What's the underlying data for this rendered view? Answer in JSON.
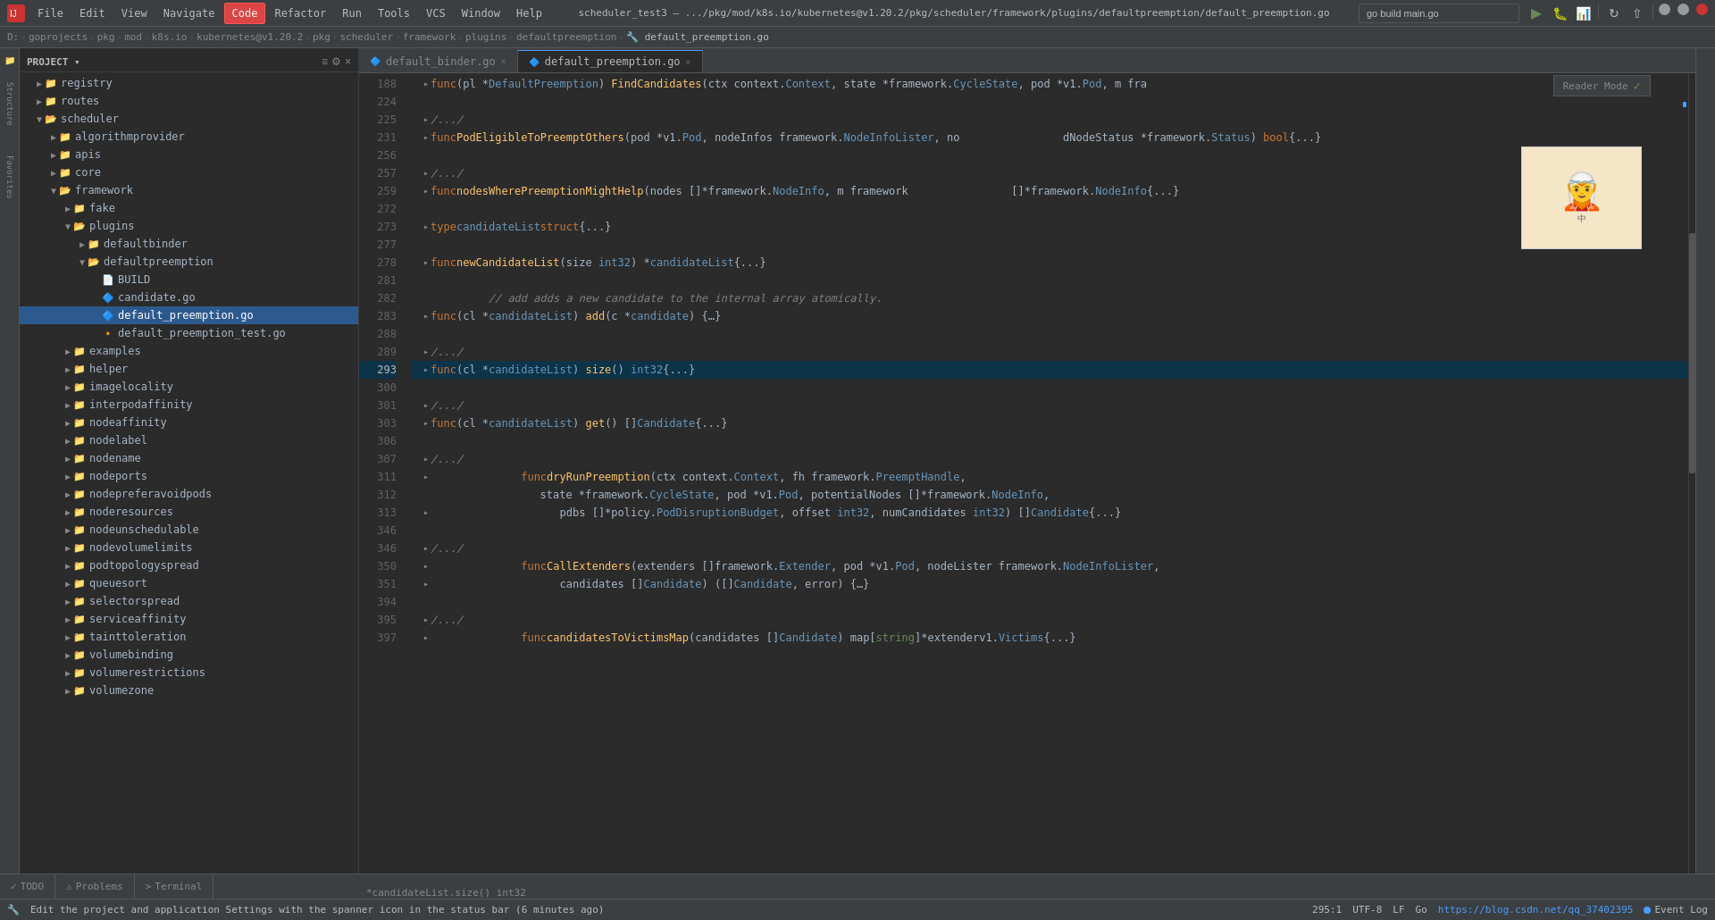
{
  "titlebar": {
    "title": "scheduler_test3 – .../pkg/mod/k8s.io/kubernetes@v1.20.2/pkg/scheduler/framework/plugins/defaultpreemption/default_preemption.go",
    "menus": [
      "File",
      "Edit",
      "View",
      "Navigate",
      "Code",
      "Refactor",
      "Run",
      "Tools",
      "VCS",
      "Window",
      "Help"
    ],
    "active_menu": "Code",
    "run_config": "go build main.go"
  },
  "breadcrumb": {
    "parts": [
      "D:",
      "goprojects",
      "pkg",
      "mod",
      "k8s.io",
      "kubernetes@v1.20.2",
      "pkg",
      "scheduler",
      "framework",
      "plugins",
      "defaultpreemption",
      "default_preemption.go"
    ]
  },
  "tabs": [
    {
      "id": "default_binder",
      "label": "default_binder.go",
      "active": false
    },
    {
      "id": "default_preemption",
      "label": "default_preemption.go",
      "active": true
    }
  ],
  "filetree": {
    "header": "Project",
    "items": [
      {
        "id": "registry",
        "label": "registry",
        "type": "folder",
        "indent": 1,
        "expanded": false
      },
      {
        "id": "routes",
        "label": "routes",
        "type": "folder",
        "indent": 1,
        "expanded": false
      },
      {
        "id": "scheduler",
        "label": "scheduler",
        "type": "folder",
        "indent": 1,
        "expanded": true
      },
      {
        "id": "algorithmprovider",
        "label": "algorithmprovider",
        "type": "folder",
        "indent": 2,
        "expanded": false
      },
      {
        "id": "apis",
        "label": "apis",
        "type": "folder",
        "indent": 2,
        "expanded": false
      },
      {
        "id": "core",
        "label": "core",
        "type": "folder",
        "indent": 2,
        "expanded": false
      },
      {
        "id": "framework",
        "label": "framework",
        "type": "folder",
        "indent": 2,
        "expanded": true
      },
      {
        "id": "fake",
        "label": "fake",
        "type": "folder",
        "indent": 3,
        "expanded": false
      },
      {
        "id": "plugins",
        "label": "plugins",
        "type": "folder",
        "indent": 3,
        "expanded": true
      },
      {
        "id": "defaultbinder",
        "label": "defaultbinder",
        "type": "folder",
        "indent": 4,
        "expanded": false
      },
      {
        "id": "defaultpreemption",
        "label": "defaultpreemption",
        "type": "folder",
        "indent": 4,
        "expanded": true
      },
      {
        "id": "BUILD",
        "label": "BUILD",
        "type": "build",
        "indent": 5
      },
      {
        "id": "candidate.go",
        "label": "candidate.go",
        "type": "go",
        "indent": 5
      },
      {
        "id": "default_preemption.go",
        "label": "default_preemption.go",
        "type": "go",
        "indent": 5,
        "selected": true
      },
      {
        "id": "default_preemption_test.go",
        "label": "default_preemption_test.go",
        "type": "gotest",
        "indent": 5
      },
      {
        "id": "examples",
        "label": "examples",
        "type": "folder",
        "indent": 3,
        "expanded": false
      },
      {
        "id": "helper",
        "label": "helper",
        "type": "folder",
        "indent": 3,
        "expanded": false
      },
      {
        "id": "imagelocality",
        "label": "imagelocality",
        "type": "folder",
        "indent": 3,
        "expanded": false
      },
      {
        "id": "interpodaffinity",
        "label": "interpodaffinity",
        "type": "folder",
        "indent": 3,
        "expanded": false
      },
      {
        "id": "nodeaffinity",
        "label": "nodeaffinity",
        "type": "folder",
        "indent": 3,
        "expanded": false
      },
      {
        "id": "nodelabel",
        "label": "nodelabel",
        "type": "folder",
        "indent": 3,
        "expanded": false
      },
      {
        "id": "nodename",
        "label": "nodename",
        "type": "folder",
        "indent": 3,
        "expanded": false
      },
      {
        "id": "nodeports",
        "label": "nodeports",
        "type": "folder",
        "indent": 3,
        "expanded": false
      },
      {
        "id": "nodepreferavoidpods",
        "label": "nodepreferavoidpods",
        "type": "folder",
        "indent": 3,
        "expanded": false
      },
      {
        "id": "noderesources",
        "label": "noderesources",
        "type": "folder",
        "indent": 3,
        "expanded": false
      },
      {
        "id": "nodeunschedulable",
        "label": "nodeunschedulable",
        "type": "folder",
        "indent": 3,
        "expanded": false
      },
      {
        "id": "nodevolumelimits",
        "label": "nodevolumelimits",
        "type": "folder",
        "indent": 3,
        "expanded": false
      },
      {
        "id": "podtopologyspread",
        "label": "podtopologyspread",
        "type": "folder",
        "indent": 3,
        "expanded": false
      },
      {
        "id": "queuesort",
        "label": "queuesort",
        "type": "folder",
        "indent": 3,
        "expanded": false
      },
      {
        "id": "selectorspread",
        "label": "selectorspread",
        "type": "folder",
        "indent": 3,
        "expanded": false
      },
      {
        "id": "serviceaffinity",
        "label": "serviceaffinity",
        "type": "folder",
        "indent": 3,
        "expanded": false
      },
      {
        "id": "tainttoleration",
        "label": "tainttoleration",
        "type": "folder",
        "indent": 3,
        "expanded": false
      },
      {
        "id": "volumebinding",
        "label": "volumebinding",
        "type": "folder",
        "indent": 3,
        "expanded": false
      },
      {
        "id": "volumerestrictions",
        "label": "volumerestrictions",
        "type": "folder",
        "indent": 3,
        "expanded": false
      },
      {
        "id": "volumezone",
        "label": "volumezone",
        "type": "folder",
        "indent": 3,
        "expanded": false
      }
    ]
  },
  "code": {
    "filename": "default_preemption.go",
    "reader_mode": "Reader Mode",
    "lines": [
      {
        "num": 188,
        "content": "func (pl *DefaultPreemption) FindCandidates(ctx context.Context, state *framework.CycleState, pod *v1.Pod, m fra",
        "collapsed": true
      },
      {
        "num": 224,
        "content": ""
      },
      {
        "num": 225,
        "content": "/.../"
      },
      {
        "num": 231,
        "content": "func PodEligibleToPreemptOthers(pod *v1.Pod, nodeInfos framework.NodeInfoLister, no                dNodeStatus *framework.Status) bool {...}",
        "collapsed": true
      },
      {
        "num": 256,
        "content": ""
      },
      {
        "num": 257,
        "content": "/.../"
      },
      {
        "num": 259,
        "content": "func nodesWherePreemptionMightHelp(nodes []*framework.NodeInfo, m framework                []*framework.NodeInfo {...}",
        "collapsed": true
      },
      {
        "num": 272,
        "content": ""
      },
      {
        "num": 273,
        "content": "type candidateList struct {...}",
        "collapsed": true
      },
      {
        "num": 277,
        "content": ""
      },
      {
        "num": 278,
        "content": "func newCandidateList(size int32) *candidateList {...}",
        "collapsed": true
      },
      {
        "num": 281,
        "content": ""
      },
      {
        "num": 282,
        "content": "// add adds a new candidate to the internal array atomically."
      },
      {
        "num": 283,
        "content": "func (cl *candidateList) add(c *candidate) {...}",
        "collapsed": true
      },
      {
        "num": 288,
        "content": ""
      },
      {
        "num": 289,
        "content": "/.../"
      },
      {
        "num": 293,
        "content": "func (cl *candidateList) size() int32 {...}",
        "highlighted": true,
        "collapsed": true
      },
      {
        "num": 300,
        "content": ""
      },
      {
        "num": 301,
        "content": "/.../"
      },
      {
        "num": 303,
        "content": "func (cl *candidateList) get() []Candidate {...}",
        "collapsed": true
      },
      {
        "num": 306,
        "content": ""
      },
      {
        "num": 307,
        "content": "/.../"
      },
      {
        "num": 311,
        "content": "    func dryRunPreemption(ctx context.Context, fh framework.PreemptHandle,"
      },
      {
        "num": 312,
        "content": "        state *framework.CycleState, pod *v1.Pod, potentialNodes []*framework.NodeInfo,"
      },
      {
        "num": 313,
        "content": "        pdbs []*policy.PodDisruptionBudget, offset int32, numCandidates int32) []Candidate {...}",
        "collapsed": true
      },
      {
        "num": 346,
        "content": ""
      },
      {
        "num": 346,
        "content": "/.../"
      },
      {
        "num": 350,
        "content": "    func CallExtenders(extenders []framework.Extender, pod *v1.Pod, nodeLister framework.NodeInfoLister,"
      },
      {
        "num": 351,
        "content": "        candidates []Candidate) ([]Candidate, error) {...}",
        "collapsed": true
      },
      {
        "num": 394,
        "content": ""
      },
      {
        "num": 395,
        "content": "/.../"
      },
      {
        "num": 397,
        "content": "    func candidatesToVictimsMap(candidates []Candidate) map[string]*extenderv1.Victims {...}",
        "collapsed": true
      }
    ]
  },
  "bottom_tabs": [
    {
      "label": "TODO",
      "icon": "✓"
    },
    {
      "label": "Problems",
      "icon": "⚠"
    },
    {
      "label": "Terminal",
      "icon": ">"
    }
  ],
  "statusbar": {
    "message": "Edit the project and application Settings with the spanner icon in the status bar (6 minutes ago)",
    "position": "295:1",
    "selection": "",
    "encoding": "UTF-8",
    "line_sep": "LF",
    "file_type": "Go",
    "event_log": "Event Log"
  },
  "right_panel": {
    "labels": [
      "Structure",
      "Favorites"
    ]
  }
}
